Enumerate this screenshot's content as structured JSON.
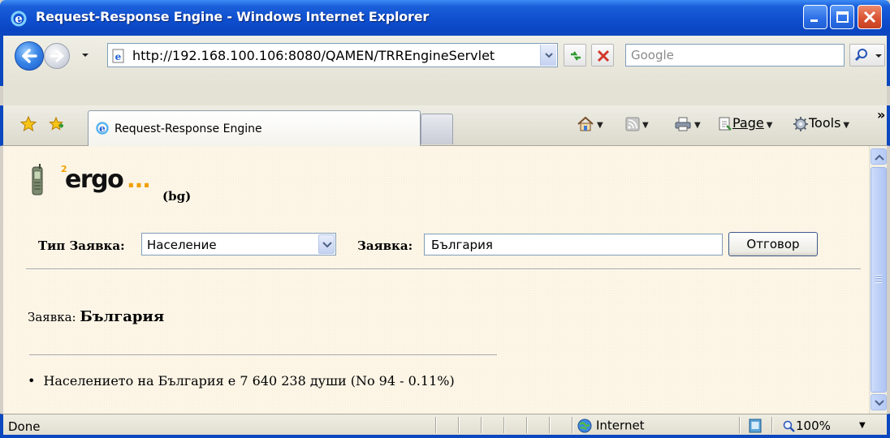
{
  "window": {
    "title": "Request-Response Engine - Windows Internet Explorer"
  },
  "addressbar": {
    "url": "http://192.168.100.106:8080/QAMEN/TRREngineServlet",
    "search_placeholder": "Google"
  },
  "tabs": [
    {
      "label": "Request-Response Engine",
      "active": true
    }
  ],
  "commandbar": {
    "page_label": "Page",
    "tools_label": "Tools",
    "chevron": "»"
  },
  "page": {
    "logo": {
      "superscript": "2",
      "text": "ergo",
      "dots": "..."
    },
    "lang": "(bg)",
    "form": {
      "request_type_label": "Тип Заявка:",
      "request_type_value": "Население",
      "request_label": "Заявка:",
      "request_value": "България",
      "answer_button": "Отговор"
    },
    "result": {
      "query_label": "Заявка:",
      "query_value": "България",
      "items": [
        "Населението на България е 7 640 238 души (No 94 - 0.11%)"
      ]
    }
  },
  "statusbar": {
    "status": "Done",
    "zone": "Internet",
    "zoom": "100%"
  },
  "colors": {
    "title_bar": "#0f4fcf",
    "content_bg": "#fdf6e7",
    "logo_accent": "#f0a000"
  }
}
